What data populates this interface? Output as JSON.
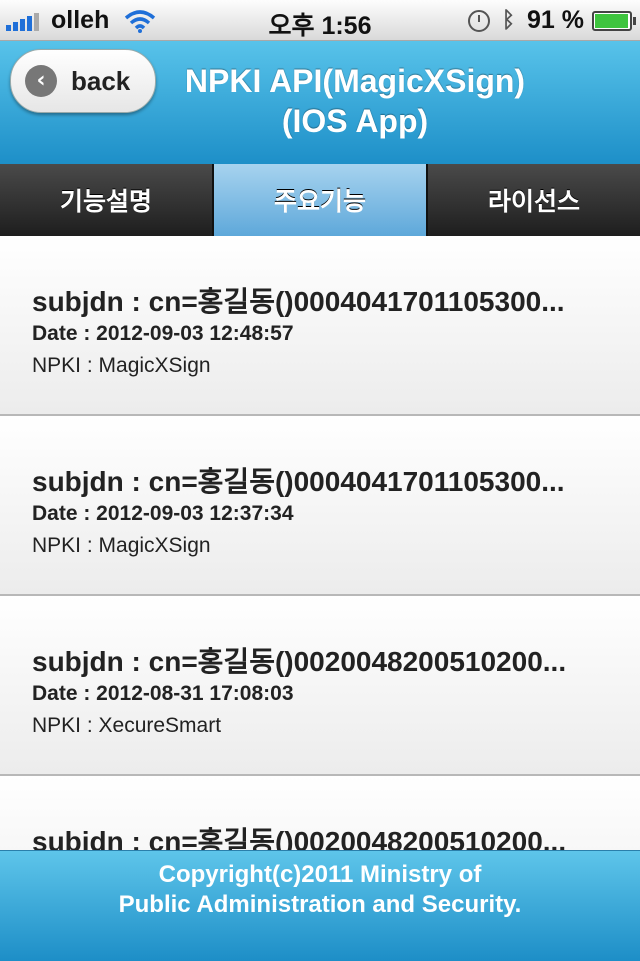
{
  "status_bar": {
    "carrier": "olleh",
    "time": "오후 1:56",
    "battery": "91 %",
    "battery_level": 0.91
  },
  "header": {
    "back_label": "back",
    "title_line1": "NPKI API(MagicXSign)",
    "title_line2": "(IOS App)"
  },
  "tabs": [
    {
      "label": "기능설명",
      "active": false
    },
    {
      "label": "주요기능",
      "active": true
    },
    {
      "label": "라이선스",
      "active": false
    }
  ],
  "items": [
    {
      "subj": "subjdn : cn=홍길동()0004041701105300...",
      "date": "Date : 2012-09-03 12:48:57",
      "npki": "NPKI : MagicXSign"
    },
    {
      "subj": "subjdn : cn=홍길동()0004041701105300...",
      "date": "Date : 2012-09-03 12:37:34",
      "npki": "NPKI : MagicXSign"
    },
    {
      "subj": "subjdn : cn=홍길동()0020048200510200...",
      "date": "Date : 2012-08-31 17:08:03",
      "npki": "NPKI : XecureSmart"
    },
    {
      "subj": "subjdn : cn=홍길동()0020048200510200...",
      "date": "",
      "npki": ""
    }
  ],
  "footer": {
    "line1": "Copyright(c)2011 Ministry of",
    "line2": "Public Administration and Security."
  },
  "colors": {
    "accent": "#1d8fc8",
    "tab_active": "#5ea8da"
  }
}
